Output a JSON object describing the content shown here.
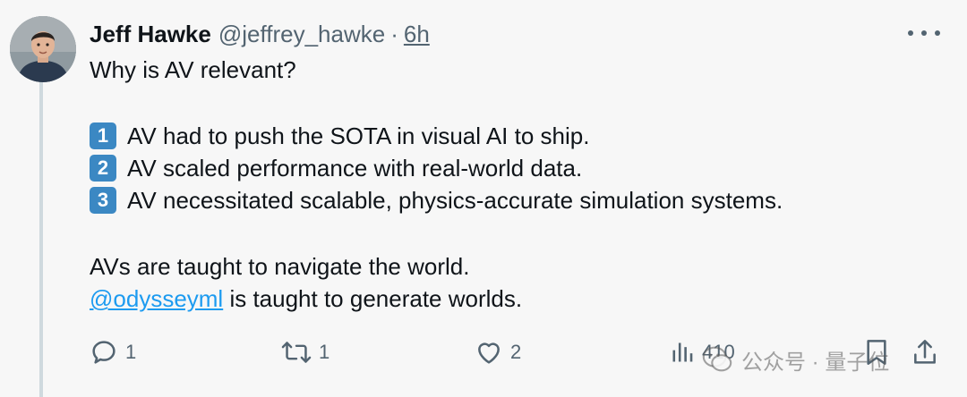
{
  "tweet": {
    "author": {
      "display_name": "Jeff Hawke",
      "handle": "@jeffrey_hawke",
      "separator": "·",
      "time": "6h"
    },
    "body": {
      "line1": "Why is AV relevant?",
      "points": [
        {
          "badge": "1",
          "text": "AV had to push the SOTA in visual AI to ship."
        },
        {
          "badge": "2",
          "text": "AV scaled performance with real-world data."
        },
        {
          "badge": "3",
          "text": "AV necessitated scalable, physics-accurate simulation systems."
        }
      ],
      "line5": "AVs are taught to navigate the world.",
      "mention": "@odysseyml",
      "line6_rest": " is taught to generate worlds."
    },
    "actions": {
      "replies": "1",
      "reposts": "1",
      "likes": "2",
      "views": "410"
    },
    "colors": {
      "accent": "#1d9bf0",
      "keycap": "#3b88c3",
      "muted": "#536471"
    }
  },
  "watermark": {
    "text": "公众号 · 量子位"
  }
}
